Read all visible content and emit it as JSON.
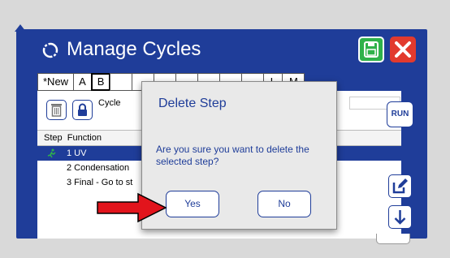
{
  "app": {
    "title": "Manage Cycles"
  },
  "tabs": [
    "*New",
    "A",
    "B",
    "",
    "",
    "",
    "",
    "",
    "",
    "",
    "L",
    "M"
  ],
  "panel": {
    "cycle_label": "Cycle",
    "steps_header": "Step  Function",
    "steps": [
      {
        "label": "1 UV",
        "selected": true
      },
      {
        "label": "2 Condensation",
        "selected": false
      },
      {
        "label": "3 Final - Go to st",
        "selected": false
      }
    ]
  },
  "side_buttons": {
    "run_label": "RUN"
  },
  "dialog": {
    "title": "Delete Step",
    "message": "Are you sure you want to delete the selected step?",
    "yes_label": "Yes",
    "no_label": "No"
  },
  "colors": {
    "brand_blue": "#1f3d99",
    "save_green": "#2fb24a",
    "close_red": "#e23a2e",
    "arrow_red": "#e2141c"
  },
  "icons": [
    "home-icon",
    "cycle-icon",
    "save-icon",
    "close-icon",
    "trash-icon",
    "lock-icon",
    "run-icon",
    "edit-icon",
    "down-arrow-icon",
    "pointer-arrow-icon"
  ]
}
